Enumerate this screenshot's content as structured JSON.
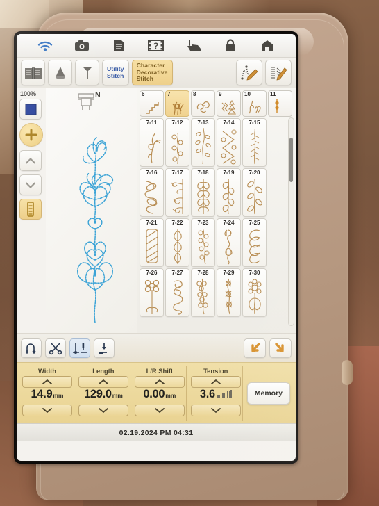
{
  "device": {
    "brand_surface": "#bda08a",
    "screen_bg": "#f4f2ee"
  },
  "status_bar": {
    "icons": [
      {
        "name": "wifi-icon",
        "label": "WiFi"
      },
      {
        "name": "camera-icon",
        "label": "Camera"
      },
      {
        "name": "document-icon",
        "label": "Manual"
      },
      {
        "name": "video-help-icon",
        "label": "Help Video"
      },
      {
        "name": "presser-foot-icon",
        "label": "Presser Foot"
      },
      {
        "name": "lock-icon",
        "label": "Lock"
      },
      {
        "name": "home-icon",
        "label": "Home"
      }
    ]
  },
  "mode_bar": {
    "buttons": [
      {
        "name": "guidebook-icon",
        "label": "Guide Book",
        "type": "icon",
        "selected": false
      },
      {
        "name": "thread-cone-icon",
        "label": "Thread Cone",
        "type": "icon",
        "selected": false
      },
      {
        "name": "needle-icon",
        "label": "Needle",
        "type": "icon",
        "selected": false
      }
    ],
    "tabs": [
      {
        "name": "tab-utility-stitch",
        "label": "Utility\nStitch",
        "selected": false
      },
      {
        "name": "tab-character-decorative-stitch",
        "label": "Character\nDecorative\nStitch",
        "selected": true
      }
    ],
    "tools": [
      {
        "name": "stitch-edit-icon",
        "label": "Stitch Edit"
      },
      {
        "name": "pattern-edit-icon",
        "label": "Pattern Edit"
      }
    ],
    "selected_color": "#efd28f",
    "utility_color": "#3d5fa8",
    "selected_text_color": "#7a5c20"
  },
  "left_panel": {
    "zoom_label": "100%",
    "buttons": [
      {
        "name": "color-swatch-button",
        "label": "Color",
        "style": "blue-square"
      },
      {
        "name": "zoom-in-button",
        "label": "+",
        "style": "yellow-round"
      },
      {
        "name": "scroll-up-button",
        "label": "Up",
        "style": "chevron-up"
      },
      {
        "name": "scroll-down-button",
        "label": "Down",
        "style": "chevron-down"
      },
      {
        "name": "stitch-length-button",
        "label": "Stitch",
        "style": "yellow-bar"
      }
    ]
  },
  "preview": {
    "presser_foot_label": "N",
    "stitch_color": "#3ba3d6"
  },
  "grid": {
    "categories": [
      {
        "name": "category-6",
        "label": "6",
        "selected": false
      },
      {
        "name": "category-7",
        "label": "7",
        "selected": true
      },
      {
        "name": "category-8",
        "label": "8",
        "selected": false
      },
      {
        "name": "category-9",
        "label": "9",
        "selected": false
      },
      {
        "name": "category-10",
        "label": "10",
        "selected": false
      },
      {
        "name": "category-11",
        "label": "11",
        "selected": false
      }
    ],
    "rows": [
      [
        {
          "code": "7-11",
          "motif": "flower-spray"
        },
        {
          "code": "7-12",
          "motif": "curl-vine"
        },
        {
          "code": "7-13",
          "motif": "leaf-cluster"
        },
        {
          "code": "7-14",
          "motif": "diamond-chain"
        },
        {
          "code": "7-15",
          "motif": "feather-fern"
        }
      ],
      [
        {
          "code": "7-16",
          "motif": "loop-wave"
        },
        {
          "code": "7-17",
          "motif": "crown-border"
        },
        {
          "code": "7-18",
          "motif": "chevron-leaf"
        },
        {
          "code": "7-19",
          "motif": "laurel-vine"
        },
        {
          "code": "7-20",
          "motif": "petal-chain"
        }
      ],
      [
        {
          "code": "7-21",
          "motif": "rope-twist"
        },
        {
          "code": "7-22",
          "motif": "leaf-beads"
        },
        {
          "code": "7-23",
          "motif": "blossom-vine"
        },
        {
          "code": "7-24",
          "motif": "tulip-swirl"
        },
        {
          "code": "7-25",
          "motif": "heart-scallop"
        }
      ],
      [
        {
          "code": "7-26",
          "motif": "clover-stem"
        },
        {
          "code": "7-27",
          "motif": "swirl-scroll"
        },
        {
          "code": "7-28",
          "motif": "flower-trail"
        },
        {
          "code": "7-29",
          "motif": "cross-flower"
        },
        {
          "code": "7-30",
          "motif": "daisy-plant"
        }
      ]
    ],
    "motif_color": "#b98f56",
    "scrollbar": {
      "name": "grid-scrollbar",
      "position": "near-top"
    }
  },
  "toolbar": {
    "buttons": [
      {
        "name": "reverse-stitch-button",
        "label": "Reverse Stitch",
        "selected": false
      },
      {
        "name": "thread-cutter-button",
        "label": "Thread Cutter",
        "selected": false
      },
      {
        "name": "needle-position-button",
        "label": "Needle Up/Down",
        "selected": true
      },
      {
        "name": "presser-foot-lift-button",
        "label": "Presser Foot Lift",
        "selected": false
      }
    ],
    "arrows": [
      {
        "name": "arrow-down-left-button",
        "label": "Previous"
      },
      {
        "name": "arrow-down-right-button",
        "label": "Next"
      }
    ],
    "arrow_color": "#d8922f"
  },
  "settings": {
    "groups": [
      {
        "name": "width-setting",
        "label": "Width",
        "value": "14.9",
        "unit": "mm"
      },
      {
        "name": "length-setting",
        "label": "Length",
        "value": "129.0",
        "unit": "mm"
      },
      {
        "name": "lr-shift-setting",
        "label": "L/R Shift",
        "value": "0.00",
        "unit": "mm"
      },
      {
        "name": "tension-setting",
        "label": "Tension",
        "value": "3.6",
        "unit": ""
      }
    ],
    "memory_label": "Memory",
    "panel_color": "#ecd795"
  },
  "date_bar": {
    "datetime": "02.19.2024  PM 04:31"
  }
}
